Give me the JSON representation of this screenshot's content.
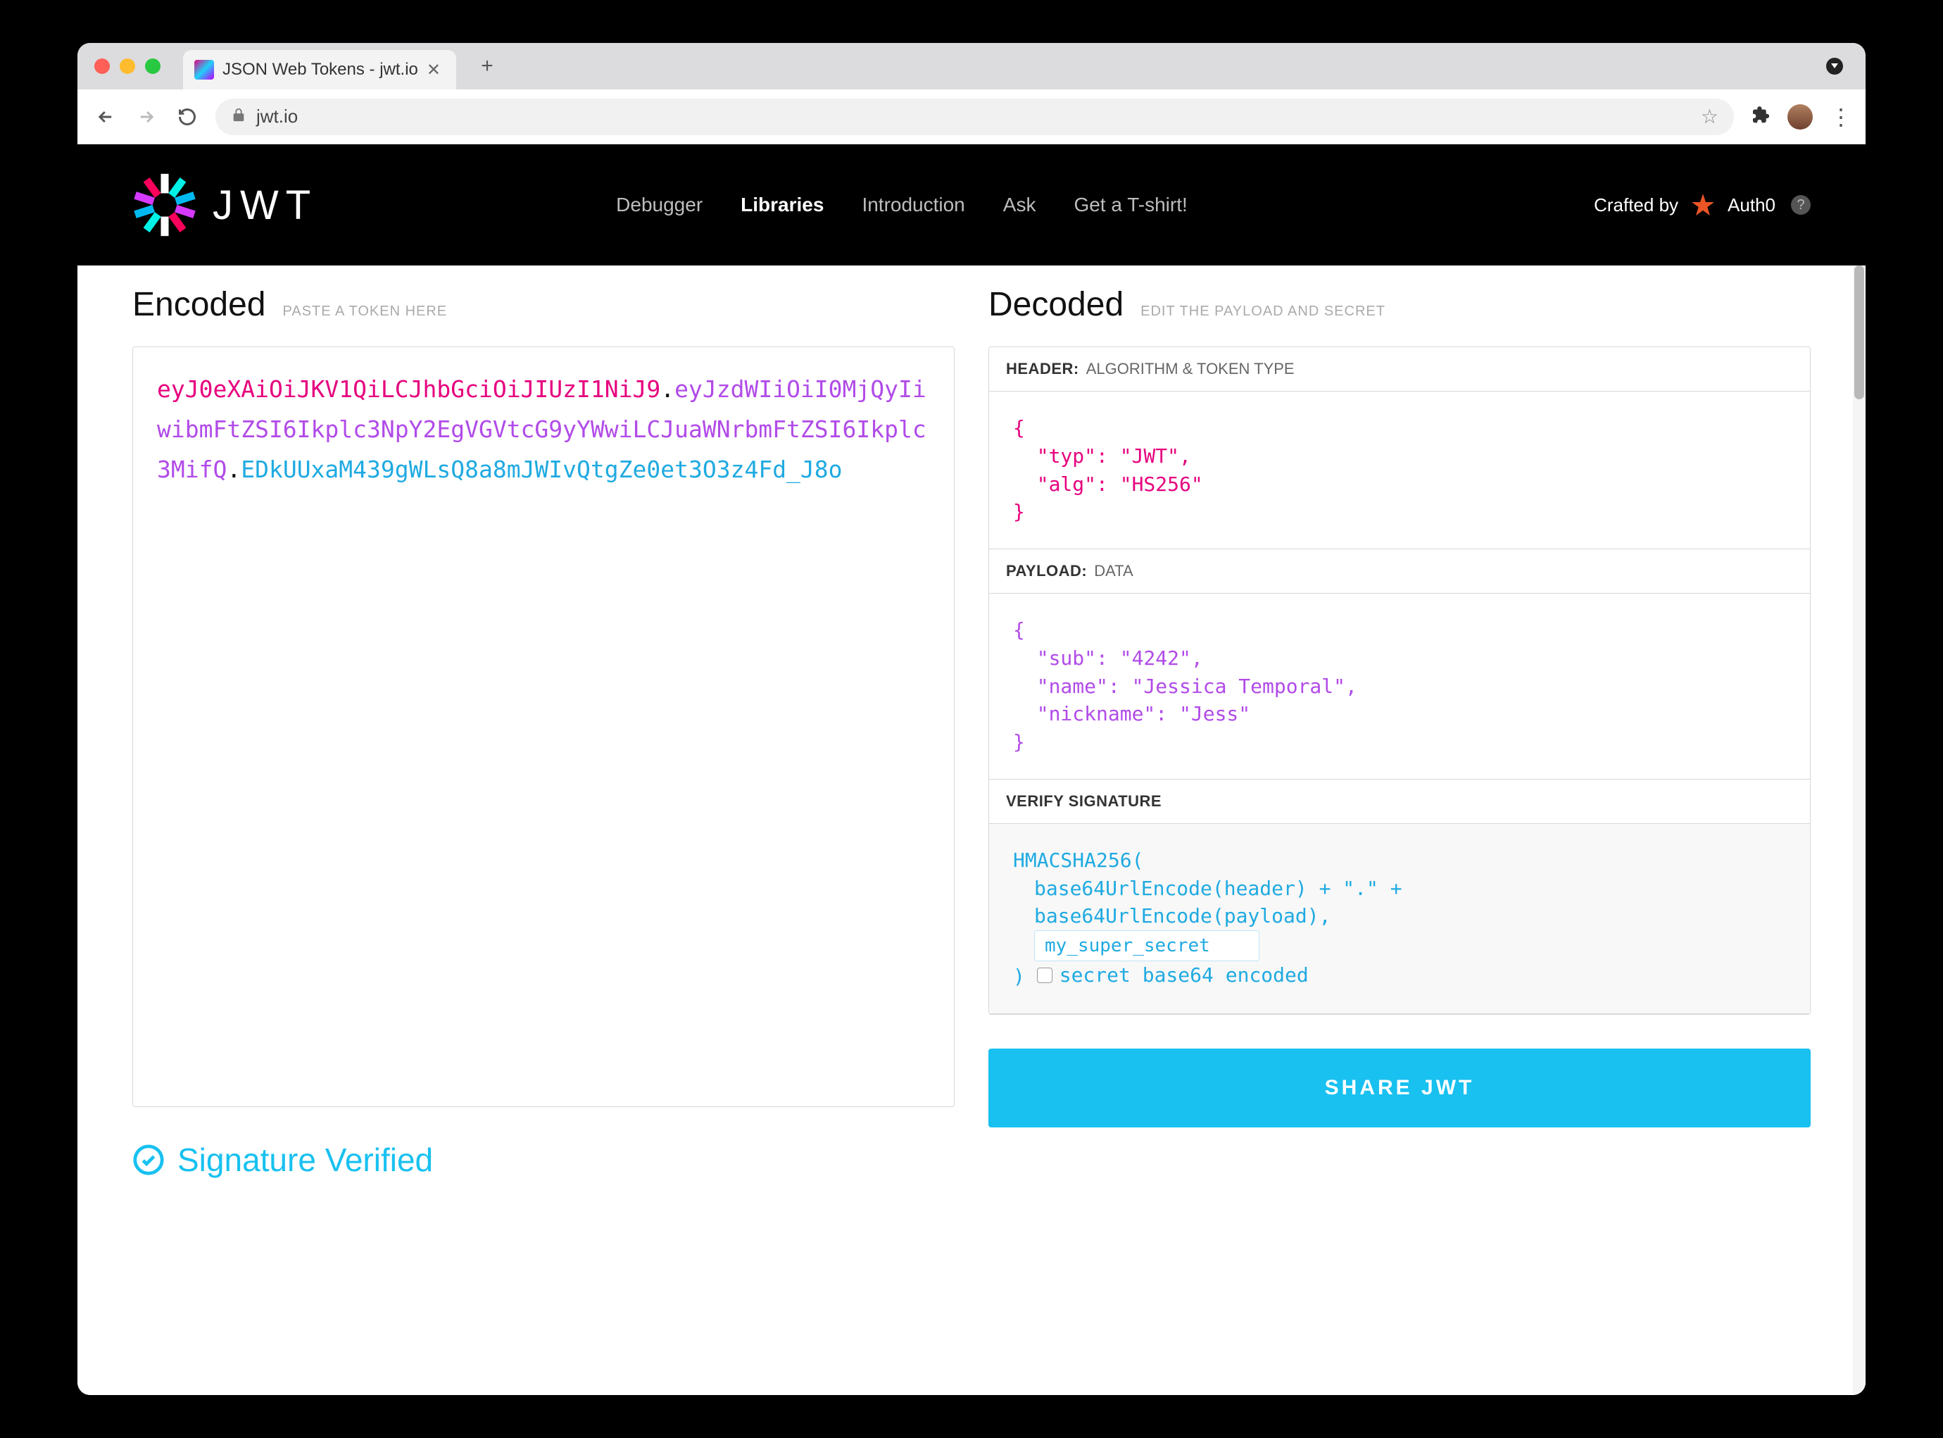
{
  "browser": {
    "tab_title": "JSON Web Tokens - jwt.io",
    "url_host": "jwt.io"
  },
  "header": {
    "nav": {
      "debugger": "Debugger",
      "libraries": "Libraries",
      "introduction": "Introduction",
      "ask": "Ask",
      "tshirt": "Get a T-shirt!"
    },
    "crafted_by_label": "Crafted by",
    "auth0_label": "Auth0"
  },
  "encoded": {
    "title": "Encoded",
    "subtitle": "PASTE A TOKEN HERE",
    "token": {
      "header": "eyJ0eXAiOiJKV1QiLCJhbGciOiJIUzI1NiJ9",
      "payload": "eyJzdWIiOiI0MjQyIiwibmFtZSI6Ikplc3NpY2EgVGVtcG9yYWwiLCJuaWNrbmFtZSI6Ikplc3MifQ",
      "signature": "EDkUUxaM439gWLsQ8a8mJWIvQtgZe0et3O3z4Fd_J8o"
    }
  },
  "decoded": {
    "title": "Decoded",
    "subtitle": "EDIT THE PAYLOAD AND SECRET",
    "header_label": "HEADER:",
    "header_sub": "ALGORITHM & TOKEN TYPE",
    "header_json": "{\n  \"typ\": \"JWT\",\n  \"alg\": \"HS256\"\n}",
    "payload_label": "PAYLOAD:",
    "payload_sub": "DATA",
    "payload_json": "{\n  \"sub\": \"4242\",\n  \"name\": \"Jessica Temporal\",\n  \"nickname\": \"Jess\"\n}",
    "verify_label": "VERIFY SIGNATURE",
    "sig": {
      "fn": "HMACSHA256(",
      "l1": "base64UrlEncode(header) + \".\" +",
      "l2": "base64UrlEncode(payload),",
      "secret_value": "my_super_secret",
      "close": ")",
      "b64_label": "secret base64 encoded"
    }
  },
  "footer": {
    "verified_label": "Signature Verified",
    "share_label": "SHARE JWT"
  },
  "colors": {
    "accent": "#18c1f0",
    "token_header": "#e6007e",
    "token_payload": "#b14be8",
    "token_sig": "#1faae1"
  }
}
